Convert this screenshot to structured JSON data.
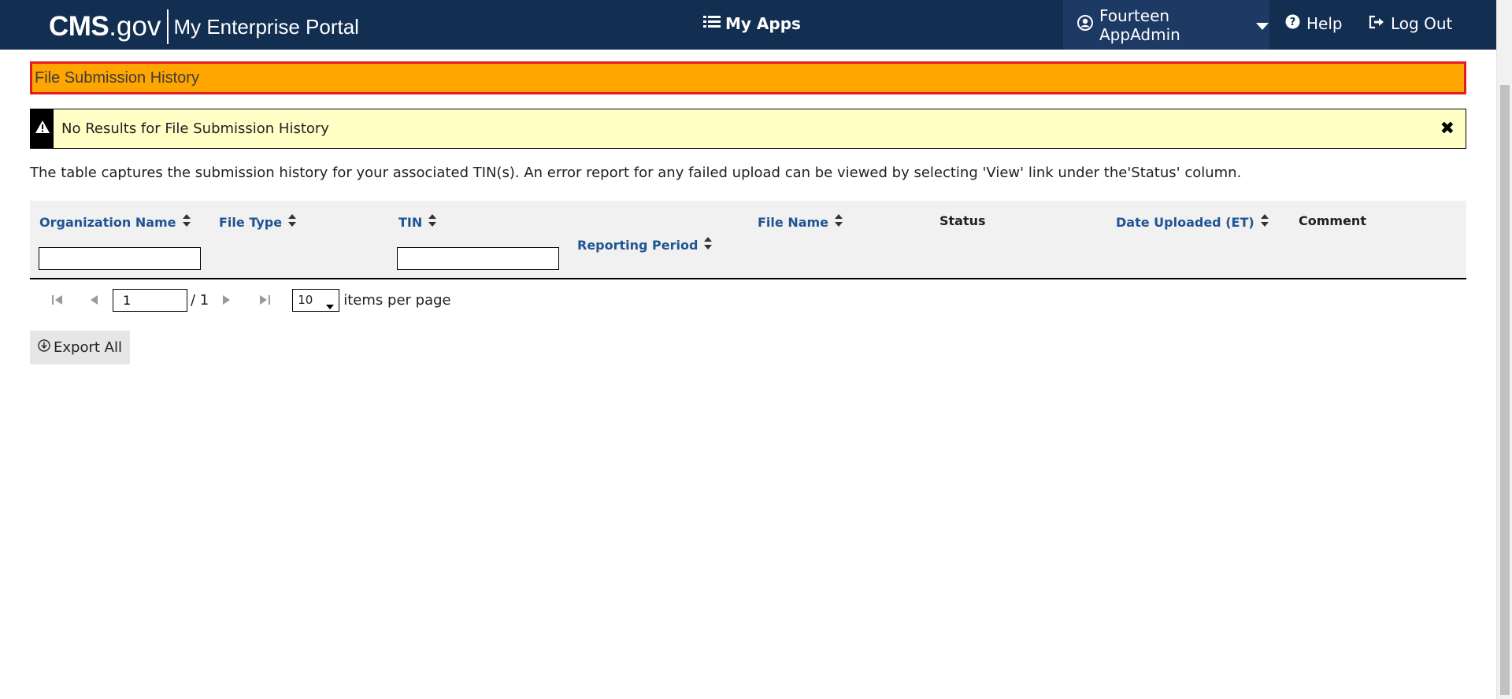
{
  "header": {
    "brand_cms": "CMS",
    "brand_gov": ".gov",
    "portal_name": "My Enterprise Portal",
    "my_apps": "My Apps",
    "user_name": "Fourteen AppAdmin",
    "help": "Help",
    "logout": "Log Out"
  },
  "page": {
    "title": "File Submission History",
    "alert_message": "No Results for File Submission History",
    "description": "The table captures the submission history for your associated TIN(s). An error report for any failed upload can be viewed by selecting 'View' link under the'Status' column."
  },
  "table": {
    "columns": [
      {
        "label": "Organization Name",
        "sortable": true
      },
      {
        "label": "File Type",
        "sortable": true
      },
      {
        "label": "TIN",
        "sortable": true
      },
      {
        "label": "Reporting Period",
        "sortable": true
      },
      {
        "label": "File Name",
        "sortable": true
      },
      {
        "label": "Status",
        "sortable": false
      },
      {
        "label": "Date Uploaded (ET)",
        "sortable": true
      },
      {
        "label": "Comment",
        "sortable": false
      }
    ],
    "org_filter_value": "",
    "tin_filter_value": ""
  },
  "pagination": {
    "current_page": "1",
    "total_pages": "/ 1",
    "per_page": "10",
    "per_page_label": "items per page"
  },
  "actions": {
    "export_all": "Export All"
  },
  "colors": {
    "header_bg": "#122e51",
    "title_banner_bg": "#ffa500",
    "title_banner_border": "#e51b23",
    "alert_bg": "#ffffc6",
    "link_blue": "#205493"
  },
  "icons": {
    "my_apps": "list-icon",
    "user": "user-circle-icon",
    "help": "question-circle-icon",
    "logout": "sign-out-icon",
    "alert": "warning-triangle-icon",
    "close": "close-icon",
    "sort": "sort-icon",
    "export": "download-circle-icon"
  }
}
